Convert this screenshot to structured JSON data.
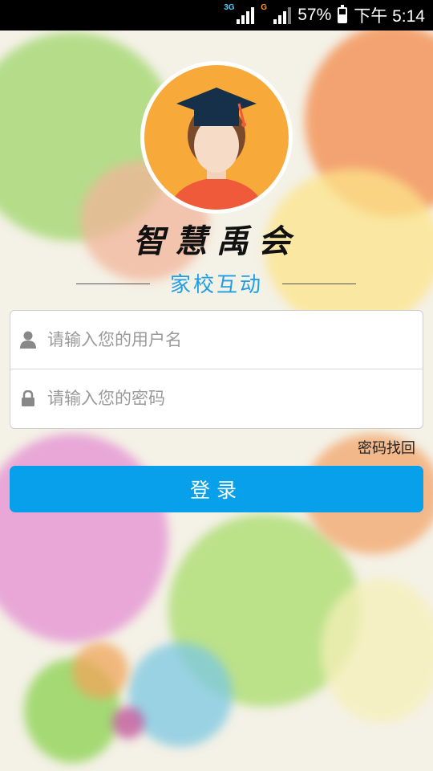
{
  "status_bar": {
    "network_1": "3G",
    "network_2": "G",
    "battery": "57%",
    "time": "下午 5:14",
    "battery_level": 0.57
  },
  "app": {
    "brand": "智慧禹会",
    "subtitle": "家校互动",
    "colors": {
      "accent": "#08a0ea",
      "subtitle": "#1d9ee6",
      "avatar_bg": "#f7aa3a"
    }
  },
  "form": {
    "username_placeholder": "请输入您的用户名",
    "username_value": "",
    "password_placeholder": "请输入您的密码",
    "password_value": ""
  },
  "forgot_password_link": "密码找回",
  "login_button": "登录",
  "icons": [
    "user-icon",
    "lock-icon",
    "graduate-avatar-icon"
  ]
}
